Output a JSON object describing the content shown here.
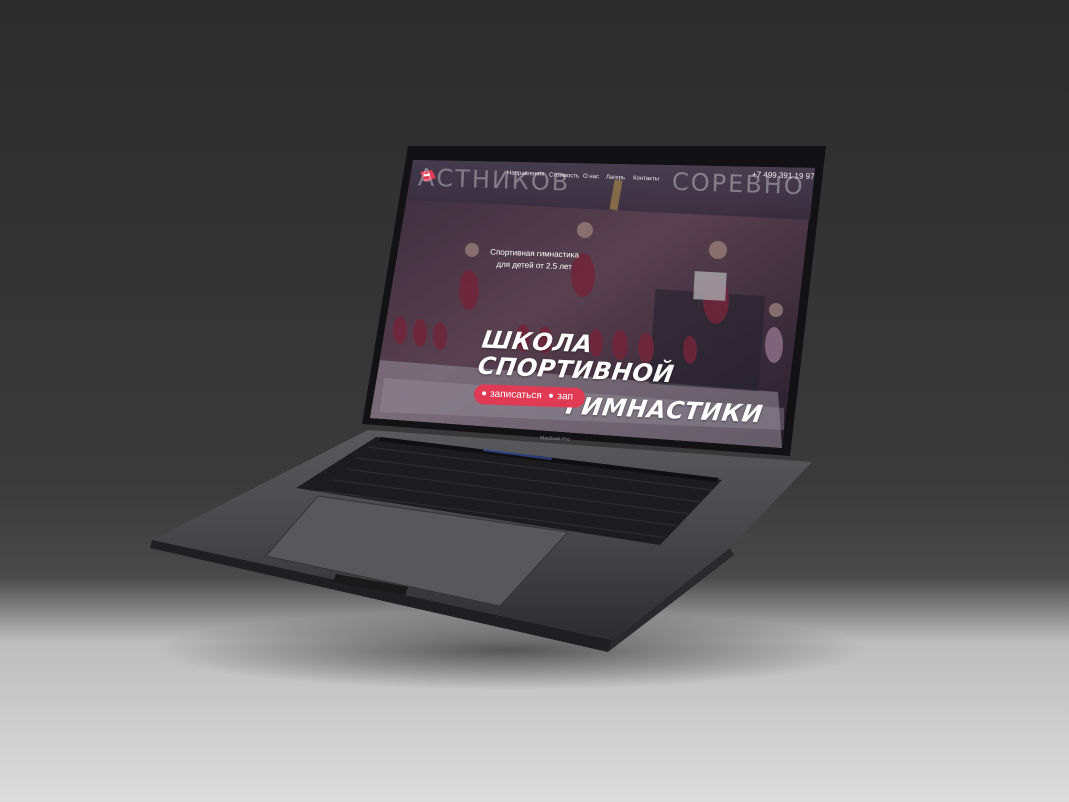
{
  "device": {
    "brand_label": "MacBook Pro"
  },
  "site": {
    "nav": [
      "Направления",
      "Стоимость",
      "О нас",
      "Лагерь",
      "Контакты"
    ],
    "phone": "+7 499 391 19 97",
    "background_words": [
      "АСТНИКОВ",
      "СОРЕВНО"
    ],
    "subtitle_line1": "Спортивная гимнастика",
    "subtitle_line2": "для детей от 2.5 лет",
    "hero_line1": "ШКОЛА",
    "hero_line2": "СПОРТИВНОЙ",
    "hero_line3": "ГИМНАСТИКИ",
    "cta_label": "записаться",
    "cta_repeat": "зап",
    "accent_color": "#e13a54",
    "logo_icon": "spartak-logo-icon"
  }
}
